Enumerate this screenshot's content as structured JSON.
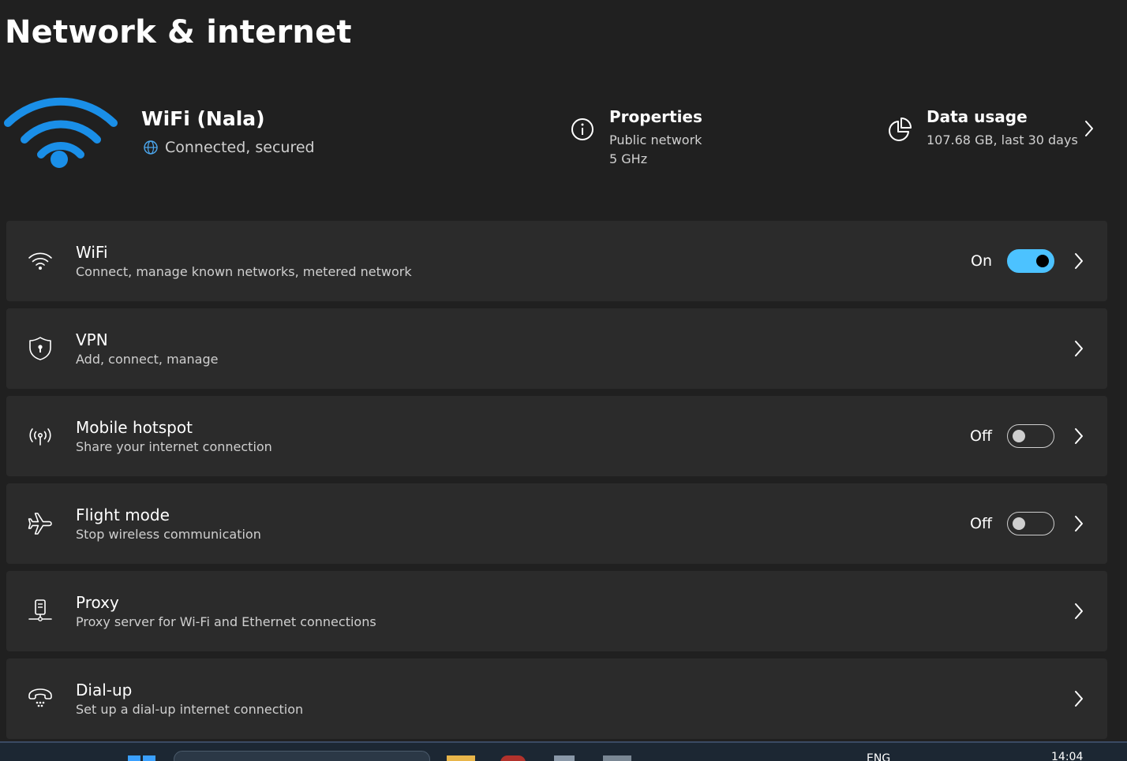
{
  "page": {
    "title": "Network & internet"
  },
  "status": {
    "network_name": "WiFi (Nala)",
    "connection_status": "Connected, secured"
  },
  "properties": {
    "title": "Properties",
    "network_type": "Public network",
    "band": "5 GHz"
  },
  "data_usage": {
    "title": "Data usage",
    "summary": "107.68 GB, last 30 days"
  },
  "settings": [
    {
      "title": "WiFi",
      "subtitle": "Connect, manage known networks, metered network",
      "state": "On",
      "toggle": true,
      "icon": "wifi-icon"
    },
    {
      "title": "VPN",
      "subtitle": "Add, connect, manage",
      "icon": "shield-icon"
    },
    {
      "title": "Mobile hotspot",
      "subtitle": "Share your internet connection",
      "state": "Off",
      "toggle": false,
      "icon": "hotspot-icon"
    },
    {
      "title": "Flight mode",
      "subtitle": "Stop wireless communication",
      "state": "Off",
      "toggle": false,
      "icon": "airplane-icon"
    },
    {
      "title": "Proxy",
      "subtitle": "Proxy server for Wi-Fi and Ethernet connections",
      "icon": "proxy-icon"
    },
    {
      "title": "Dial-up",
      "subtitle": "Set up a dial-up internet connection",
      "icon": "dialup-phone-icon"
    }
  ],
  "taskbar": {
    "language": "ENG",
    "time": "14:04"
  },
  "colors": {
    "accent": "#4cc2ff",
    "wifi_hero": "#1a8fe8",
    "background": "#202020",
    "card": "#2b2b2b"
  }
}
